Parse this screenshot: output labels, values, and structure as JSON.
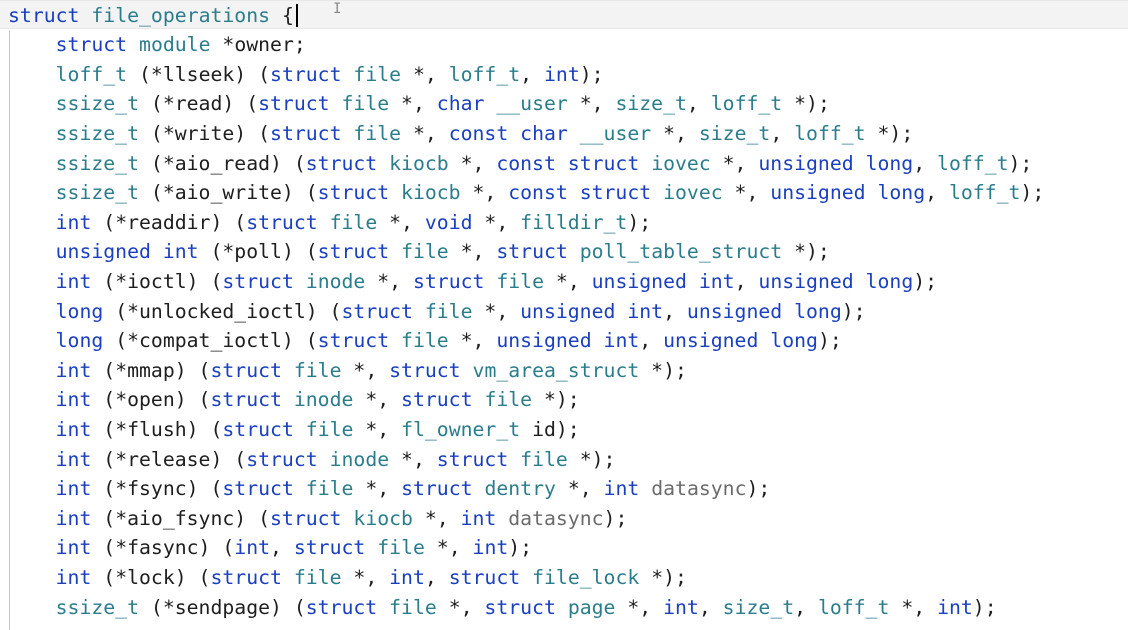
{
  "editor": {
    "lines": [
      [
        {
          "t": "struct",
          "c": "k"
        },
        {
          "t": " "
        },
        {
          "t": "file_operations",
          "c": "t"
        },
        {
          "t": " {"
        }
      ],
      [
        {
          "t": "    "
        },
        {
          "t": "struct",
          "c": "k"
        },
        {
          "t": " "
        },
        {
          "t": "module",
          "c": "t"
        },
        {
          "t": " *owner;"
        }
      ],
      [
        {
          "t": "    "
        },
        {
          "t": "loff_t",
          "c": "t"
        },
        {
          "t": " (*llseek) ("
        },
        {
          "t": "struct",
          "c": "k"
        },
        {
          "t": " "
        },
        {
          "t": "file",
          "c": "t"
        },
        {
          "t": " *, "
        },
        {
          "t": "loff_t",
          "c": "t"
        },
        {
          "t": ", "
        },
        {
          "t": "int",
          "c": "k"
        },
        {
          "t": ");"
        }
      ],
      [
        {
          "t": "    "
        },
        {
          "t": "ssize_t",
          "c": "t"
        },
        {
          "t": " (*read) ("
        },
        {
          "t": "struct",
          "c": "k"
        },
        {
          "t": " "
        },
        {
          "t": "file",
          "c": "t"
        },
        {
          "t": " *, "
        },
        {
          "t": "char",
          "c": "k"
        },
        {
          "t": " "
        },
        {
          "t": "__user",
          "c": "t"
        },
        {
          "t": " *, "
        },
        {
          "t": "size_t",
          "c": "t"
        },
        {
          "t": ", "
        },
        {
          "t": "loff_t",
          "c": "t"
        },
        {
          "t": " *);"
        }
      ],
      [
        {
          "t": "    "
        },
        {
          "t": "ssize_t",
          "c": "t"
        },
        {
          "t": " (*write) ("
        },
        {
          "t": "struct",
          "c": "k"
        },
        {
          "t": " "
        },
        {
          "t": "file",
          "c": "t"
        },
        {
          "t": " *, "
        },
        {
          "t": "const",
          "c": "k"
        },
        {
          "t": " "
        },
        {
          "t": "char",
          "c": "k"
        },
        {
          "t": " "
        },
        {
          "t": "__user",
          "c": "t"
        },
        {
          "t": " *, "
        },
        {
          "t": "size_t",
          "c": "t"
        },
        {
          "t": ", "
        },
        {
          "t": "loff_t",
          "c": "t"
        },
        {
          "t": " *);"
        }
      ],
      [
        {
          "t": "    "
        },
        {
          "t": "ssize_t",
          "c": "t"
        },
        {
          "t": " (*aio_read) ("
        },
        {
          "t": "struct",
          "c": "k"
        },
        {
          "t": " "
        },
        {
          "t": "kiocb",
          "c": "t"
        },
        {
          "t": " *, "
        },
        {
          "t": "const",
          "c": "k"
        },
        {
          "t": " "
        },
        {
          "t": "struct",
          "c": "k"
        },
        {
          "t": " "
        },
        {
          "t": "iovec",
          "c": "t"
        },
        {
          "t": " *, "
        },
        {
          "t": "unsigned",
          "c": "k"
        },
        {
          "t": " "
        },
        {
          "t": "long",
          "c": "k"
        },
        {
          "t": ", "
        },
        {
          "t": "loff_t",
          "c": "t"
        },
        {
          "t": ");"
        }
      ],
      [
        {
          "t": "    "
        },
        {
          "t": "ssize_t",
          "c": "t"
        },
        {
          "t": " (*aio_write) ("
        },
        {
          "t": "struct",
          "c": "k"
        },
        {
          "t": " "
        },
        {
          "t": "kiocb",
          "c": "t"
        },
        {
          "t": " *, "
        },
        {
          "t": "const",
          "c": "k"
        },
        {
          "t": " "
        },
        {
          "t": "struct",
          "c": "k"
        },
        {
          "t": " "
        },
        {
          "t": "iovec",
          "c": "t"
        },
        {
          "t": " *, "
        },
        {
          "t": "unsigned",
          "c": "k"
        },
        {
          "t": " "
        },
        {
          "t": "long",
          "c": "k"
        },
        {
          "t": ", "
        },
        {
          "t": "loff_t",
          "c": "t"
        },
        {
          "t": ");"
        }
      ],
      [
        {
          "t": "    "
        },
        {
          "t": "int",
          "c": "k"
        },
        {
          "t": " (*readdir) ("
        },
        {
          "t": "struct",
          "c": "k"
        },
        {
          "t": " "
        },
        {
          "t": "file",
          "c": "t"
        },
        {
          "t": " *, "
        },
        {
          "t": "void",
          "c": "k"
        },
        {
          "t": " *, "
        },
        {
          "t": "filldir_t",
          "c": "t"
        },
        {
          "t": ");"
        }
      ],
      [
        {
          "t": "    "
        },
        {
          "t": "unsigned",
          "c": "k"
        },
        {
          "t": " "
        },
        {
          "t": "int",
          "c": "k"
        },
        {
          "t": " (*poll) ("
        },
        {
          "t": "struct",
          "c": "k"
        },
        {
          "t": " "
        },
        {
          "t": "file",
          "c": "t"
        },
        {
          "t": " *, "
        },
        {
          "t": "struct",
          "c": "k"
        },
        {
          "t": " "
        },
        {
          "t": "poll_table_struct",
          "c": "t"
        },
        {
          "t": " *);"
        }
      ],
      [
        {
          "t": "    "
        },
        {
          "t": "int",
          "c": "k"
        },
        {
          "t": " (*ioctl) ("
        },
        {
          "t": "struct",
          "c": "k"
        },
        {
          "t": " "
        },
        {
          "t": "inode",
          "c": "t"
        },
        {
          "t": " *, "
        },
        {
          "t": "struct",
          "c": "k"
        },
        {
          "t": " "
        },
        {
          "t": "file",
          "c": "t"
        },
        {
          "t": " *, "
        },
        {
          "t": "unsigned",
          "c": "k"
        },
        {
          "t": " "
        },
        {
          "t": "int",
          "c": "k"
        },
        {
          "t": ", "
        },
        {
          "t": "unsigned",
          "c": "k"
        },
        {
          "t": " "
        },
        {
          "t": "long",
          "c": "k"
        },
        {
          "t": ");"
        }
      ],
      [
        {
          "t": "    "
        },
        {
          "t": "long",
          "c": "k"
        },
        {
          "t": " (*unlocked_ioctl) ("
        },
        {
          "t": "struct",
          "c": "k"
        },
        {
          "t": " "
        },
        {
          "t": "file",
          "c": "t"
        },
        {
          "t": " *, "
        },
        {
          "t": "unsigned",
          "c": "k"
        },
        {
          "t": " "
        },
        {
          "t": "int",
          "c": "k"
        },
        {
          "t": ", "
        },
        {
          "t": "unsigned",
          "c": "k"
        },
        {
          "t": " "
        },
        {
          "t": "long",
          "c": "k"
        },
        {
          "t": ");"
        }
      ],
      [
        {
          "t": "    "
        },
        {
          "t": "long",
          "c": "k"
        },
        {
          "t": " (*compat_ioctl) ("
        },
        {
          "t": "struct",
          "c": "k"
        },
        {
          "t": " "
        },
        {
          "t": "file",
          "c": "t"
        },
        {
          "t": " *, "
        },
        {
          "t": "unsigned",
          "c": "k"
        },
        {
          "t": " "
        },
        {
          "t": "int",
          "c": "k"
        },
        {
          "t": ", "
        },
        {
          "t": "unsigned",
          "c": "k"
        },
        {
          "t": " "
        },
        {
          "t": "long",
          "c": "k"
        },
        {
          "t": ");"
        }
      ],
      [
        {
          "t": "    "
        },
        {
          "t": "int",
          "c": "k"
        },
        {
          "t": " (*mmap) ("
        },
        {
          "t": "struct",
          "c": "k"
        },
        {
          "t": " "
        },
        {
          "t": "file",
          "c": "t"
        },
        {
          "t": " *, "
        },
        {
          "t": "struct",
          "c": "k"
        },
        {
          "t": " "
        },
        {
          "t": "vm_area_struct",
          "c": "t"
        },
        {
          "t": " *);"
        }
      ],
      [
        {
          "t": "    "
        },
        {
          "t": "int",
          "c": "k"
        },
        {
          "t": " (*open) ("
        },
        {
          "t": "struct",
          "c": "k"
        },
        {
          "t": " "
        },
        {
          "t": "inode",
          "c": "t"
        },
        {
          "t": " *, "
        },
        {
          "t": "struct",
          "c": "k"
        },
        {
          "t": " "
        },
        {
          "t": "file",
          "c": "t"
        },
        {
          "t": " *);"
        }
      ],
      [
        {
          "t": "    "
        },
        {
          "t": "int",
          "c": "k"
        },
        {
          "t": " (*flush) ("
        },
        {
          "t": "struct",
          "c": "k"
        },
        {
          "t": " "
        },
        {
          "t": "file",
          "c": "t"
        },
        {
          "t": " *, "
        },
        {
          "t": "fl_owner_t",
          "c": "t"
        },
        {
          "t": " id);"
        }
      ],
      [
        {
          "t": "    "
        },
        {
          "t": "int",
          "c": "k"
        },
        {
          "t": " (*release) ("
        },
        {
          "t": "struct",
          "c": "k"
        },
        {
          "t": " "
        },
        {
          "t": "inode",
          "c": "t"
        },
        {
          "t": " *, "
        },
        {
          "t": "struct",
          "c": "k"
        },
        {
          "t": " "
        },
        {
          "t": "file",
          "c": "t"
        },
        {
          "t": " *);"
        }
      ],
      [
        {
          "t": "    "
        },
        {
          "t": "int",
          "c": "k"
        },
        {
          "t": " (*fsync) ("
        },
        {
          "t": "struct",
          "c": "k"
        },
        {
          "t": " "
        },
        {
          "t": "file",
          "c": "t"
        },
        {
          "t": " *, "
        },
        {
          "t": "struct",
          "c": "k"
        },
        {
          "t": " "
        },
        {
          "t": "dentry",
          "c": "t"
        },
        {
          "t": " *, "
        },
        {
          "t": "int",
          "c": "k"
        },
        {
          "t": " "
        },
        {
          "t": "datasync",
          "c": "p"
        },
        {
          "t": ");"
        }
      ],
      [
        {
          "t": "    "
        },
        {
          "t": "int",
          "c": "k"
        },
        {
          "t": " (*aio_fsync) ("
        },
        {
          "t": "struct",
          "c": "k"
        },
        {
          "t": " "
        },
        {
          "t": "kiocb",
          "c": "t"
        },
        {
          "t": " *, "
        },
        {
          "t": "int",
          "c": "k"
        },
        {
          "t": " "
        },
        {
          "t": "datasync",
          "c": "p"
        },
        {
          "t": ");"
        }
      ],
      [
        {
          "t": "    "
        },
        {
          "t": "int",
          "c": "k"
        },
        {
          "t": " (*fasync) ("
        },
        {
          "t": "int",
          "c": "k"
        },
        {
          "t": ", "
        },
        {
          "t": "struct",
          "c": "k"
        },
        {
          "t": " "
        },
        {
          "t": "file",
          "c": "t"
        },
        {
          "t": " *, "
        },
        {
          "t": "int",
          "c": "k"
        },
        {
          "t": ");"
        }
      ],
      [
        {
          "t": "    "
        },
        {
          "t": "int",
          "c": "k"
        },
        {
          "t": " (*lock) ("
        },
        {
          "t": "struct",
          "c": "k"
        },
        {
          "t": " "
        },
        {
          "t": "file",
          "c": "t"
        },
        {
          "t": " *, "
        },
        {
          "t": "int",
          "c": "k"
        },
        {
          "t": ", "
        },
        {
          "t": "struct",
          "c": "k"
        },
        {
          "t": " "
        },
        {
          "t": "file_lock",
          "c": "t"
        },
        {
          "t": " *);"
        }
      ],
      [
        {
          "t": "    "
        },
        {
          "t": "ssize_t",
          "c": "t"
        },
        {
          "t": " (*sendpage) ("
        },
        {
          "t": "struct",
          "c": "k"
        },
        {
          "t": " "
        },
        {
          "t": "file",
          "c": "t"
        },
        {
          "t": " *, "
        },
        {
          "t": "struct",
          "c": "k"
        },
        {
          "t": " "
        },
        {
          "t": "page",
          "c": "t"
        },
        {
          "t": " *, "
        },
        {
          "t": "int",
          "c": "k"
        },
        {
          "t": ", "
        },
        {
          "t": "size_t",
          "c": "t"
        },
        {
          "t": ", "
        },
        {
          "t": "loff_t",
          "c": "t"
        },
        {
          "t": " *, "
        },
        {
          "t": "int",
          "c": "k"
        },
        {
          "t": ");"
        }
      ]
    ],
    "colors": {
      "keyword": "#1a3fbf",
      "type": "#2b7d8c",
      "parameter": "#6b6b6b",
      "punctuation": "#1e1e1e",
      "current_line": "#f3f3f3"
    },
    "icons": [
      "text-cursor-icon",
      "ibeam-pointer-icon"
    ]
  }
}
